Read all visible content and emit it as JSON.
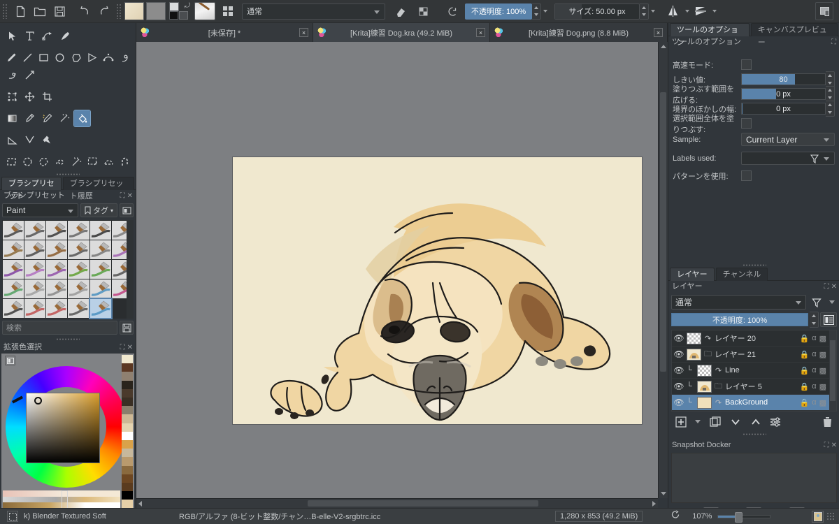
{
  "toolbar": {
    "icons": [
      "new-document-icon",
      "open-folder-icon",
      "save-icon",
      "undo-icon",
      "redo-icon"
    ],
    "blend_mode": "通常",
    "opacity_label": "不透明度: 100%",
    "size_label": "サイズ: 50.00 px",
    "mirror_h_icon": "mirror-horizontal-icon",
    "mirror_v_icon": "mirror-vertical-icon",
    "eraser_icon": "eraser-icon",
    "pattern_icon": "pattern-icon",
    "reload_icon": "reload-preset-icon",
    "wrap_icon": "wraparound-icon",
    "far_right_icon": "show-docker-icon"
  },
  "doc_tabs": [
    {
      "label": "[未保存] *",
      "active": false,
      "close": "×"
    },
    {
      "label": "[Krita]練習 Dog.kra (49.2 MiB)",
      "active": true,
      "close": "×"
    },
    {
      "label": "[Krita]練習 Dog.png (8.8 MiB)",
      "active": false,
      "close": "×"
    }
  ],
  "tools": {
    "selected": "fill-tool",
    "rows": [
      [
        "select-shapes-icon",
        "text-icon",
        "edit-shapes-icon",
        "calligraphy-icon"
      ],
      [
        "freehand-brush-icon",
        "line-icon",
        "rectangle-icon",
        "ellipse-icon",
        "polygon-icon",
        "polyline-icon",
        "bezier-curve-icon",
        "freehand-path-icon"
      ],
      [
        "dynamic-brush-icon",
        "multibrush-icon"
      ],
      [
        "transform-icon",
        "move-icon",
        "crop-icon"
      ],
      [
        "gradient-icon",
        "color-picker-icon",
        "colorize-mask-icon",
        "smart-patch-icon",
        "fill-tool"
      ],
      [
        "measure-icon",
        "reference-angle-icon",
        "assistant-icon"
      ],
      [
        "rectangular-select-icon",
        "elliptical-select-icon",
        "polygonal-select-icon",
        "freehand-select-icon",
        "contiguous-select-icon",
        "similar-color-select-icon",
        "bezier-select-icon",
        "magnetic-select-icon"
      ]
    ]
  },
  "brush_presets": {
    "tabs": [
      {
        "label": "ブラシプリセット",
        "active": true
      },
      {
        "label": "ブラシプリセット履歴",
        "active": false
      }
    ],
    "dock_title": "ブラシプリセット",
    "filter_value": "Paint",
    "tag_label": "タグ",
    "search_placeholder": "検索",
    "save_icon": "save-icon",
    "columns": 6,
    "rows": 5,
    "selected_index": 28
  },
  "color_selector": {
    "dock_title": "拡張色選択",
    "settings_icon": "settings-icon",
    "reset_icon": "reset-color-icon",
    "palette": [
      "#f0e8cf",
      "#5b3722",
      "#8f8070",
      "#2a241c",
      "#4a3a2c",
      "#3a2f24",
      "#8a7f6c",
      "#cdb895",
      "#e4d3b0",
      "#ffffff",
      "#d9a24a",
      "#c7b89c",
      "#b99a6d",
      "#8a6a3e",
      "#6d4722",
      "#5a3b1e",
      "#000000",
      "#e6d0a8",
      "#d9f0ef",
      "#8b4a2a"
    ],
    "ramps": [
      "#f1d8c7",
      "#cfd0d1",
      "#8a6a3a"
    ]
  },
  "tool_options": {
    "tabs": [
      {
        "label": "ツールのオプション",
        "active": true
      },
      {
        "label": "キャンバスプレビュー",
        "active": false
      }
    ],
    "dock_title": "ツールのオプション",
    "rows": [
      {
        "label": "高速モード:",
        "type": "checkbox",
        "value": ""
      },
      {
        "label": "しきい値:",
        "type": "slider",
        "value": "80",
        "fill_pct": 64
      },
      {
        "label": "塗りつぶす範囲を広げる:",
        "type": "slider",
        "value": "0 px",
        "fill_pct": 40
      },
      {
        "label": "境界のぼかしの幅:",
        "type": "slider",
        "value": "0 px",
        "fill_pct": 1
      },
      {
        "label": "選択範囲全体を塗りつぶす:",
        "type": "checkbox",
        "value": ""
      },
      {
        "label": "Sample:",
        "type": "combo",
        "value": "Current Layer"
      },
      {
        "label": "Labels used:",
        "type": "combo-filter",
        "value": ""
      },
      {
        "label": "パターンを使用:",
        "type": "checkbox",
        "value": ""
      }
    ]
  },
  "layers": {
    "tabs": [
      {
        "label": "レイヤー",
        "active": true
      },
      {
        "label": "チャンネル",
        "active": false
      }
    ],
    "dock_title": "レイヤー",
    "blend_mode": "通常",
    "opacity_label": "不透明度: 100%",
    "filter_icon": "filter-icon",
    "properties_icon": "layer-properties-icon",
    "rows": [
      {
        "name": "レイヤー 20",
        "indent": 0,
        "thumb": "checker",
        "type_icon": "transparency-mask-icon",
        "selected": false,
        "alpha": "α",
        "lock": "lock-icon"
      },
      {
        "name": "レイヤー 21",
        "indent": 0,
        "thumb": "dog",
        "type_icon": "group-layer-icon",
        "selected": false,
        "alpha": "α",
        "lock": "lock-icon"
      },
      {
        "name": "Line",
        "indent": 1,
        "thumb": "checker",
        "type_icon": "transparency-mask-icon",
        "selected": false,
        "alpha": "α",
        "lock": "lock-icon"
      },
      {
        "name": "レイヤー 5",
        "indent": 1,
        "thumb": "dog",
        "type_icon": "group-layer-icon",
        "selected": false,
        "alpha": "α",
        "lock": "lock-icon"
      },
      {
        "name": "BackGround",
        "indent": 1,
        "thumb": "cream",
        "type_icon": "transparency-mask-icon",
        "selected": true,
        "alpha": "α",
        "lock": "lock-icon"
      }
    ],
    "buttons": [
      "add-layer-icon",
      "add-layer-dropdown-icon",
      "duplicate-layer-icon",
      "move-layer-down-icon",
      "move-layer-up-icon",
      "layer-properties-icon",
      "delete-layer-icon"
    ]
  },
  "snapshot": {
    "dock_title": "Snapshot Docker",
    "buttons": [
      "add-snapshot-icon",
      "camera-icon",
      "delete-snapshot-icon"
    ]
  },
  "status_bar": {
    "brush_preset": "k) Blender Textured Soft",
    "color_space": "RGB/アルファ (8-ビット整数/チャン…B-elle-V2-srgbtrc.icc",
    "doc_size": "1,280 x 853 (49.2 MiB)",
    "zoom": "107%",
    "selection_icon": "selection-mode-icon",
    "rotate_icon": "canvas-rotation-icon",
    "fit_icon": "fit-page-icon"
  },
  "canvas": {
    "background": "#7d7f82",
    "artboard_color": "#f0e8cf",
    "artwork_name": "sleeping-bulldog-illustration"
  }
}
